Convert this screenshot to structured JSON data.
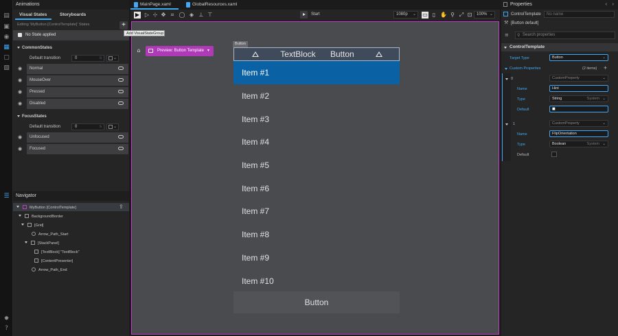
{
  "left_panel": {
    "title": "Animations",
    "tabs": [
      {
        "label": "Visual States"
      },
      {
        "label": "Storyboards"
      }
    ],
    "editing_text": "Editing 'MyButton [ControlTemplate]' States",
    "add_button": "+",
    "add_tooltip": "Add VisualStateGroup",
    "no_state_label": "No State applied",
    "groups": [
      {
        "name": "CommonStates",
        "transition_label": "Default transition",
        "transition_value": "0",
        "transition_unit": "s",
        "states": [
          "Normal",
          "MouseOver",
          "Pressed",
          "Disabled"
        ]
      },
      {
        "name": "FocusStates",
        "transition_label": "Default transition",
        "transition_value": "0",
        "transition_unit": "s",
        "states": [
          "Unfocused",
          "Focused"
        ]
      }
    ]
  },
  "navigator": {
    "title": "Navigator",
    "nodes": [
      {
        "label": "MyButton [ControlTemplate]"
      },
      {
        "label": "BackgroundBorder"
      },
      {
        "label": "[Grid]"
      },
      {
        "label": "Arrow_Path_Start"
      },
      {
        "label": "[StackPanel]"
      },
      {
        "label": "[TextBlock] \"TextBlock\""
      },
      {
        "label": "[ContentPresenter]"
      },
      {
        "label": "Arrow_Path_End"
      }
    ]
  },
  "document_tabs": [
    {
      "label": "MainPage.xaml"
    },
    {
      "label": "GlobalResources.xaml"
    }
  ],
  "toolbar": {
    "start_label": "Start",
    "resolution": "1080p",
    "zoom": "100%"
  },
  "template_selector": {
    "label": "Preview: Button Template"
  },
  "canvas": {
    "button_tag": "Button",
    "header_text": "TextBlock Button",
    "items": [
      "Item #1",
      "Item #2",
      "Item #3",
      "Item #4",
      "Item #5",
      "Item #6",
      "Item #7",
      "Item #8",
      "Item #9",
      "Item #10"
    ],
    "bottom_button": "Button"
  },
  "properties": {
    "title": "Properties",
    "element_type": "ControlTemplate",
    "name_placeholder": "No name",
    "element_label": "[Button default]",
    "search_placeholder": "Search properties",
    "section": "ControlTemplate",
    "target_type_label": "Target Type",
    "target_type_value": "Button",
    "custom_props_label": "Custom Properties",
    "custom_props_count": "(2 items)",
    "custom_props_add": "+",
    "entries": [
      {
        "index": "0",
        "kind": "CustomProperty",
        "name_label": "Name",
        "name_value": "Hint",
        "type_label": "Type",
        "type_value": "String",
        "type_ns": "System",
        "default_label": "Default",
        "default_value": "■"
      },
      {
        "index": "1",
        "kind": "CustomProperty",
        "name_label": "Name",
        "name_value": "FlipOrientation",
        "type_label": "Type",
        "type_value": "Boolean",
        "type_ns": "System",
        "default_label": "Default"
      }
    ]
  },
  "colors": {
    "accent": "#3fa9f5",
    "selection": "#0a62a5",
    "template_border": "#c23cc9"
  }
}
